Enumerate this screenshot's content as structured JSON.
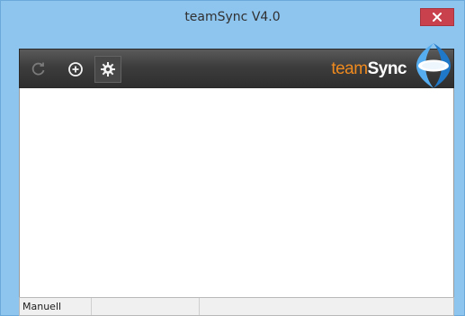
{
  "window": {
    "title": "teamSync V4.0",
    "close_icon": "close-icon"
  },
  "toolbar": {
    "buttons": [
      {
        "icon": "refresh-icon",
        "enabled": false
      },
      {
        "icon": "add-circle-icon",
        "enabled": true
      },
      {
        "icon": "gear-icon",
        "enabled": true
      }
    ]
  },
  "brand": {
    "text_part1": "team",
    "text_part2": "Sync",
    "logo_icon": "teamsync-logo"
  },
  "statusbar": {
    "mode": "Manuell"
  },
  "colors": {
    "titlebar": "#8ec5ef",
    "close_button": "#c9414c",
    "toolbar": "#3d3d3d",
    "brand_orange": "#ef8a1f",
    "logo_blue": "#2f8fd9"
  }
}
